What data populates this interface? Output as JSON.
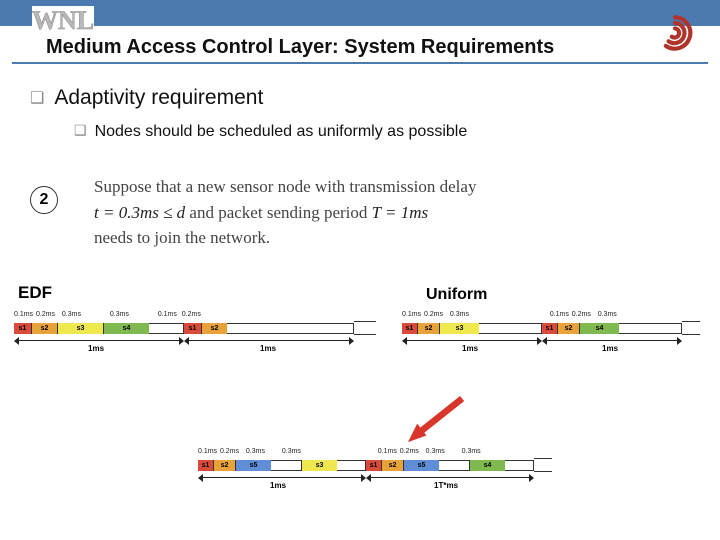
{
  "header": {
    "wnl": "WNL"
  },
  "title": "Medium Access Control Layer: System Requirements",
  "bullets": {
    "level1": "Adaptivity requirement",
    "level2": "Nodes should be scheduled as uniformly as possible"
  },
  "circle_number": "2",
  "scenario": {
    "line1_pre": "Suppose that a new sensor node with transmission delay",
    "line2_math": "t = 0.3ms ≤ d",
    "line2_mid": " and packet sending period ",
    "line2_math2": "T = 1ms",
    "line3": "needs to join the network."
  },
  "labels": {
    "edf": "EDF",
    "uniform": "Uniform",
    "span_1ms": "1ms",
    "span_1Tms": "1T*ms"
  },
  "ticks": {
    "d01": "0.1ms",
    "d02": "0.2ms",
    "d03": "0.3ms",
    "d01b": "0.1ms",
    "d02b": "0.2ms"
  },
  "slots": {
    "s1": "s1",
    "s2": "s2",
    "s3": "s3",
    "s4": "s4",
    "s5": "s5"
  },
  "colors": {
    "accent": "#4a7ab0",
    "arrow": "#d8362a"
  }
}
